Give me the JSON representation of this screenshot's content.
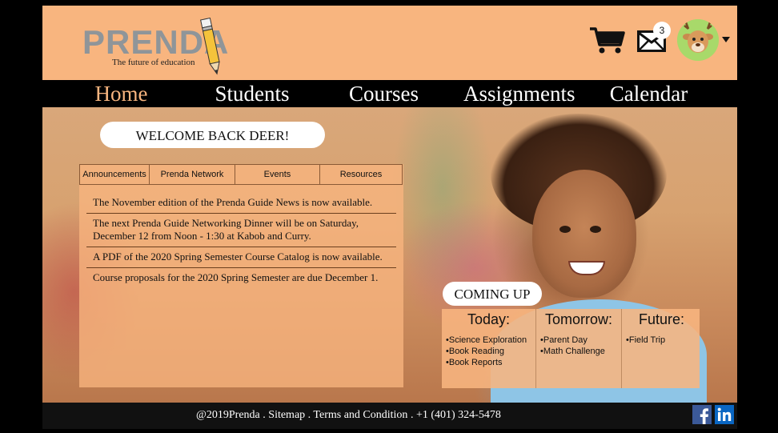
{
  "logo": {
    "word": "PRENDA",
    "tagline": "The future of education"
  },
  "header": {
    "mail_count": "3"
  },
  "nav": {
    "items": [
      {
        "label": "Home"
      },
      {
        "label": "Students"
      },
      {
        "label": "Courses"
      },
      {
        "label": "Assignments"
      },
      {
        "label": "Calendar"
      }
    ],
    "active": "Home"
  },
  "welcome": "WELCOME BACK DEER!",
  "tabs": [
    {
      "label": "Announcements"
    },
    {
      "label": "Prenda Network"
    },
    {
      "label": "Events"
    },
    {
      "label": "Resources"
    }
  ],
  "announcements": [
    {
      "text": "The November edition of the Prenda Guide News is now available."
    },
    {
      "text": "The next Prenda Guide Networking Dinner will be on Saturday, December 12 from Noon - 1:30 at Kabob and Curry."
    },
    {
      "text": "A PDF of the 2020 Spring Semester Course Catalog is now available."
    },
    {
      "text": "Course proposals for the 2020 Spring Semester are due December 1."
    }
  ],
  "coming_up": {
    "title": "COMING UP",
    "columns": [
      {
        "heading": "Today:",
        "items": [
          "•Science Exploration",
          "•Book Reading",
          "•Book Reports"
        ]
      },
      {
        "heading": "Tomorrow:",
        "items": [
          "•Parent Day",
          "•Math Challenge"
        ]
      },
      {
        "heading": "Future:",
        "items": [
          "•Field Trip"
        ]
      }
    ]
  },
  "footer": {
    "copyright": "@2019Prenda",
    "sitemap": "Sitemap",
    "terms": "Terms and Condition",
    "phone": "+1 (401) 324-5478",
    "separator": " . "
  },
  "colors": {
    "brand": "#f8b57f",
    "nav_bg": "#000000",
    "active_nav": "#f8b57f"
  },
  "icons": [
    "pencil-icon",
    "cart-icon",
    "mail-icon",
    "chevron-down-icon",
    "facebook-icon",
    "linkedin-icon"
  ]
}
